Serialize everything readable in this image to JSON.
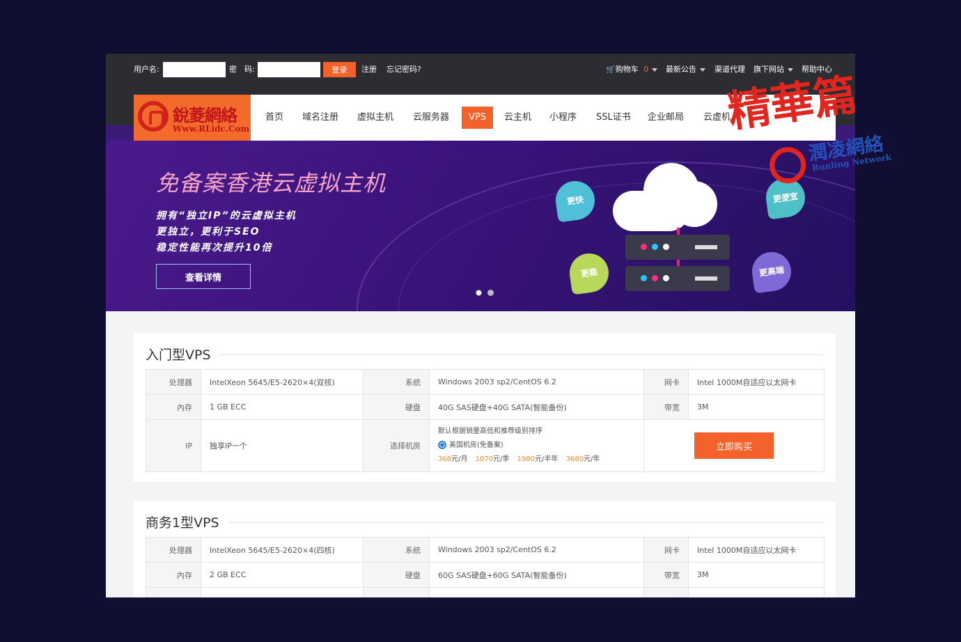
{
  "topbar": {
    "username_label": "用户名:",
    "password_label": "密　码:",
    "login_label": "登录",
    "register_label": "注册",
    "forgot_label": "忘记密码?",
    "cart_label": "购物车",
    "cart_count": "0",
    "announce_label": "最新公告",
    "agent_label": "渠道代理",
    "sites_label": "旗下网站",
    "help_label": "帮助中心"
  },
  "logo": {
    "name": "銳菱網絡",
    "url": "Www.RLidc.Com"
  },
  "nav": [
    {
      "label": "首页"
    },
    {
      "label": "域名注册"
    },
    {
      "label": "虚拟主机"
    },
    {
      "label": "云服务器"
    },
    {
      "label": "VPS"
    },
    {
      "label": "云主机"
    },
    {
      "label": "小程序"
    },
    {
      "label": "SSL证书"
    },
    {
      "label": "企业邮局"
    },
    {
      "label": "云虚机"
    }
  ],
  "banner": {
    "title": "免备案香港云虚拟主机",
    "lines": [
      "拥有“独立IP”的云虚拟主机",
      "更独立，更利于SEO",
      "稳定性能再次提升10倍"
    ],
    "button": "查看详情",
    "bubbles": [
      "更快",
      "更便宜",
      "更稳",
      "更高端"
    ]
  },
  "products": [
    {
      "title": "入门型VPS",
      "rows": [
        [
          "处理器",
          "IntelXeon 5645/E5-2620×4(双核)",
          "系統",
          "Windows 2003 sp2/CentOS 6.2",
          "网卡",
          "Intel 1000M自适应以太网卡"
        ],
        [
          "內存",
          "1 GB ECC",
          "硬盘",
          "40G SAS硬盘+40G SATA(智能备份)",
          "带宽",
          "3M"
        ]
      ],
      "ip_label": "IP",
      "ip_value": "独享IP一个",
      "room_label": "选择机房",
      "room_note": "默认根据销量高低和推荐级别排序",
      "room_option": "美国机房(免备案)",
      "prices": [
        {
          "amount": "368",
          "unit": "元/月"
        },
        {
          "amount": "1070",
          "unit": "元/季"
        },
        {
          "amount": "1980",
          "unit": "元/半年"
        },
        {
          "amount": "3680",
          "unit": "元/年"
        }
      ],
      "buy_label": "立即购买"
    },
    {
      "title": "商务1型VPS",
      "rows": [
        [
          "处理器",
          "IntelXeon 5645/E5-2620×4(四核)",
          "系統",
          "Windows 2003 sp2/CentOS 6.2",
          "网卡",
          "Intel 1000M自适应以太网卡"
        ],
        [
          "內存",
          "2 GB ECC",
          "硬盘",
          "60G SAS硬盘+60G SATA(智能备份)",
          "带宽",
          "3M"
        ]
      ]
    }
  ],
  "watermark": {
    "title": "精華篇",
    "name": "潤凌網絡",
    "sub": "Runling Network"
  },
  "colors": {
    "accent": "#f3622a",
    "price": "#f08a2b",
    "topbar": "#2b2d32",
    "page_bg": "#100f33"
  }
}
